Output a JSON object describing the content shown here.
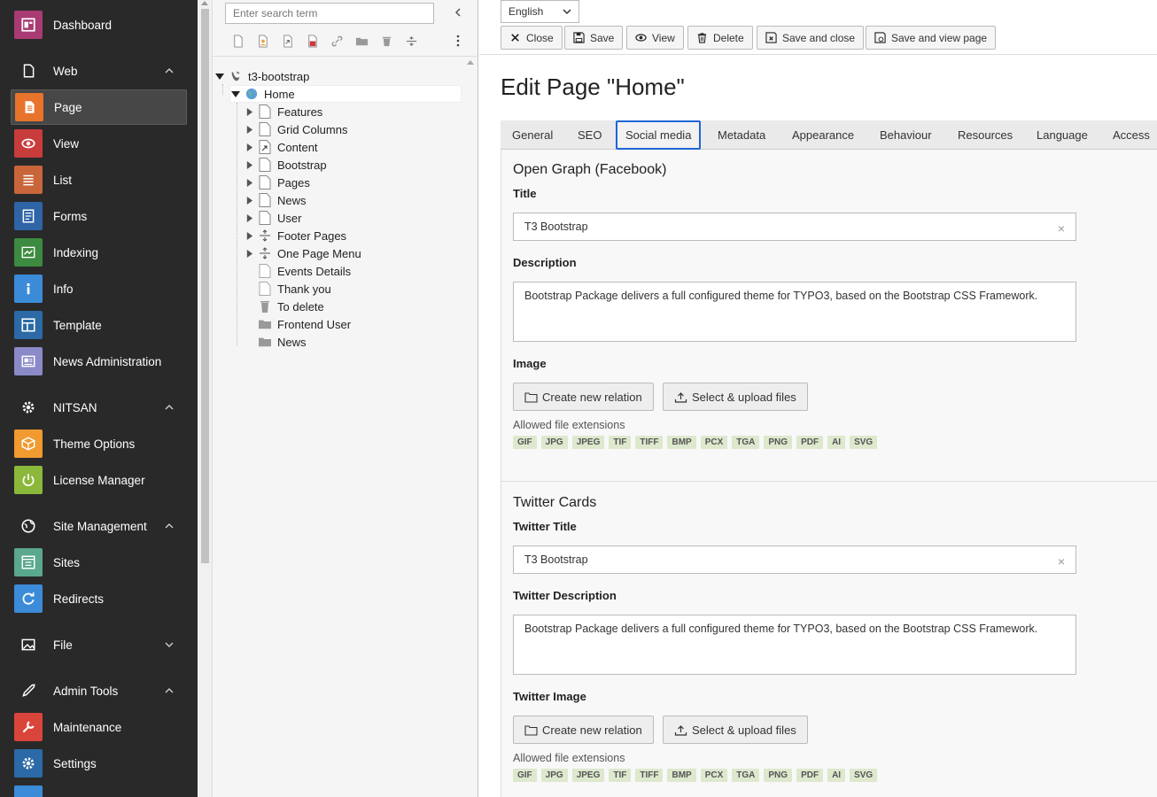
{
  "modules": {
    "dashboard": {
      "label": "Dashboard",
      "color": "#a83b73",
      "icon": "dashboard-icon"
    },
    "web_group": {
      "label": "Web",
      "icon": "page-outline-icon"
    },
    "page": {
      "label": "Page",
      "color": "#e8732b",
      "icon": "page-module-icon"
    },
    "view": {
      "label": "View",
      "color": "#c83c3c",
      "icon": "eye-icon"
    },
    "list": {
      "label": "List",
      "color": "#c8653b",
      "icon": "list-icon"
    },
    "forms": {
      "label": "Forms",
      "color": "#2f64a7",
      "icon": "forms-icon"
    },
    "indexing": {
      "label": "Indexing",
      "color": "#3d8b40",
      "icon": "indexing-icon"
    },
    "info": {
      "label": "Info",
      "color": "#3b8bd8",
      "icon": "info-icon"
    },
    "template": {
      "label": "Template",
      "color": "#2b6aa6",
      "icon": "template-icon"
    },
    "news_admin": {
      "label": "News Administration",
      "color": "#8a8ac8",
      "icon": "news-icon"
    },
    "nitsan_group": {
      "label": "NITSAN",
      "icon": "gear-icon"
    },
    "theme_options": {
      "label": "Theme Options",
      "color": "#f09a30",
      "icon": "box-icon"
    },
    "license_manager": {
      "label": "License Manager",
      "color": "#8bb83a",
      "icon": "power-icon"
    },
    "site_group": {
      "label": "Site Management",
      "icon": "globe-icon"
    },
    "sites": {
      "label": "Sites",
      "color": "#5aa88d",
      "icon": "sites-icon"
    },
    "redirects": {
      "label": "Redirects",
      "color": "#3b8bd8",
      "icon": "redirect-icon"
    },
    "file_group": {
      "label": "File",
      "icon": "image-icon"
    },
    "admin_group": {
      "label": "Admin Tools",
      "icon": "rocket-icon"
    },
    "maintenance": {
      "label": "Maintenance",
      "color": "#d9453b",
      "icon": "wrench-icon"
    },
    "settings": {
      "label": "Settings",
      "color": "#2b6aa6",
      "icon": "settings-icon"
    }
  },
  "tree": {
    "search_placeholder": "Enter search term",
    "root": "t3-bootstrap",
    "home": "Home",
    "children": [
      "Features",
      "Grid Columns",
      "Content",
      "Bootstrap",
      "Pages",
      "News",
      "User",
      "Footer Pages",
      "One Page Menu",
      "Events Details",
      "Thank you",
      "To delete",
      "Frontend User",
      "News"
    ]
  },
  "content": {
    "language": "English",
    "buttons": {
      "close": "Close",
      "save": "Save",
      "view": "View",
      "delete": "Delete",
      "save_close": "Save and close",
      "save_view": "Save and view page"
    },
    "page_title": "Edit Page \"Home\"",
    "tabs": [
      "General",
      "SEO",
      "Social media",
      "Metadata",
      "Appearance",
      "Behaviour",
      "Resources",
      "Language",
      "Access"
    ],
    "active_tab": "Social media",
    "og": {
      "section": "Open Graph (Facebook)",
      "title_label": "Title",
      "title_value": "T3 Bootstrap",
      "desc_label": "Description",
      "desc_value": "Bootstrap Package delivers a full configured theme for TYPO3, based on the Bootstrap CSS Framework.",
      "image_label": "Image",
      "create_btn": "Create new relation",
      "upload_btn": "Select & upload files",
      "allowed": "Allowed file extensions"
    },
    "twitter": {
      "section": "Twitter Cards",
      "title_label": "Twitter Title",
      "title_value": "T3 Bootstrap",
      "desc_label": "Twitter Description",
      "desc_value": "Bootstrap Package delivers a full configured theme for TYPO3, based on the Bootstrap CSS Framework.",
      "image_label": "Twitter Image",
      "create_btn": "Create new relation",
      "upload_btn": "Select & upload files",
      "allowed": "Allowed file extensions"
    },
    "extensions": [
      "GIF",
      "JPG",
      "JPEG",
      "TIF",
      "TIFF",
      "BMP",
      "PCX",
      "TGA",
      "PNG",
      "PDF",
      "AI",
      "SVG"
    ],
    "clear_glyph": "×"
  }
}
